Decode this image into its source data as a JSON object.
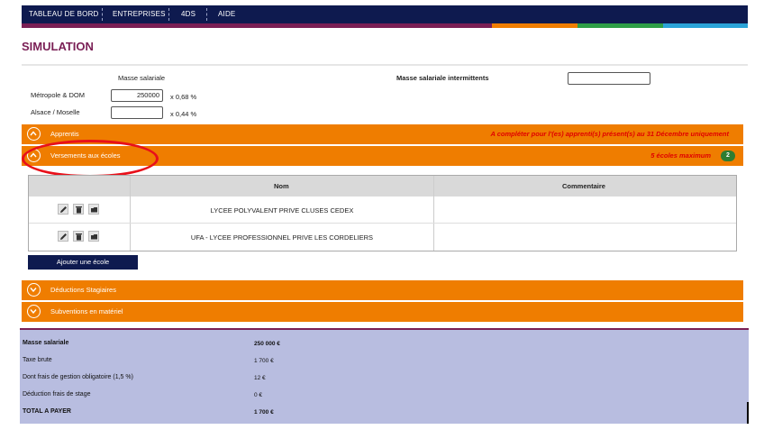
{
  "nav": {
    "items": [
      "TABLEAU DE BORD",
      "ENTREPRISES",
      "4DS",
      "AIDE"
    ],
    "bg": "#0e1a4f",
    "stripe_colors": [
      "#7a1f55",
      "#ef7d00",
      "#2e9e47",
      "#2aa3d8"
    ]
  },
  "page": {
    "title": "SIMULATION"
  },
  "form": {
    "masse_salariale_label": "Masse salariale",
    "intermittents_label": "Masse salariale intermittents",
    "intermittents_value": "",
    "metropole_label": "Métropole & DOM",
    "metropole_value": "250000",
    "metropole_rate": "x 0,68 %",
    "alsace_label": "Alsace / Moselle",
    "alsace_value": "",
    "alsace_rate": "x 0,44 %"
  },
  "sections": {
    "apprentis": {
      "label": "Apprentis",
      "note": "A compléter pour l'(es) apprenti(s) présent(s) au 31 Décembre uniquement"
    },
    "versements": {
      "label": "Versements aux écoles",
      "note": "5 écoles maximum",
      "count": "2"
    },
    "deductions": {
      "label": "Déductions Stagiaires"
    },
    "subventions": {
      "label": "Subventions en matériel"
    }
  },
  "schools_table": {
    "headers": {
      "nom": "Nom",
      "commentaire": "Commentaire"
    },
    "rows": [
      {
        "nom": "LYCEE POLYVALENT PRIVE CLUSES CEDEX",
        "commentaire": ""
      },
      {
        "nom": "UFA - LYCEE PROFESSIONNEL PRIVE LES CORDELIERS",
        "commentaire": ""
      }
    ],
    "add_button": "Ajouter une école"
  },
  "summary": {
    "rows": [
      {
        "label": "Masse salariale",
        "value": "250 000 €",
        "bold": true
      },
      {
        "label": "Taxe brute",
        "value": "1 700 €",
        "bold": false
      },
      {
        "label": "Dont frais de gestion obligatoire (1,5 %)",
        "value": "12 €",
        "bold": false
      },
      {
        "label": "Déduction frais de stage",
        "value": "0 €",
        "bold": false
      },
      {
        "label": "TOTAL A PAYER",
        "value": "1 700 €",
        "bold": true
      }
    ]
  },
  "colors": {
    "orange": "#ef7d00",
    "title": "#7a1f55",
    "summary_bg": "#b8bde0",
    "highlight": "#e8101a"
  }
}
